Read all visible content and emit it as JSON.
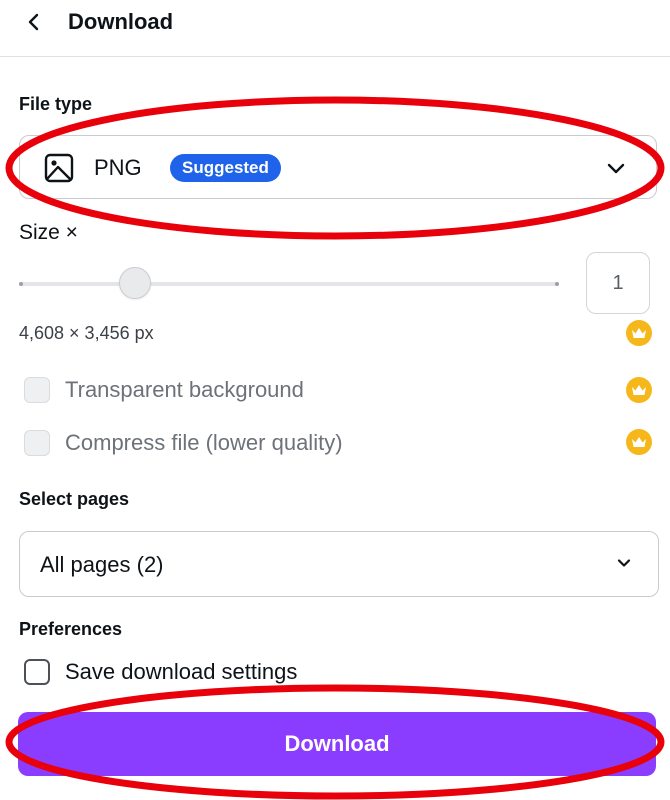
{
  "header": {
    "title": "Download",
    "back_icon": "chevron-left-icon"
  },
  "file_type": {
    "label": "File type",
    "value": "PNG",
    "icon": "image-icon",
    "badge": "Suggested"
  },
  "size": {
    "label": "Size ×",
    "value": "1",
    "slider_fraction": 0.2,
    "dimensions": "4,608 × 3,456 px"
  },
  "options": {
    "transparent_label": "Transparent background",
    "compress_label": "Compress file (lower quality)"
  },
  "pages": {
    "label": "Select pages",
    "value": "All pages (2)"
  },
  "preferences": {
    "label": "Preferences",
    "save_settings_label": "Save download settings"
  },
  "download_button": "Download",
  "colors": {
    "accent": "#8b3dff",
    "badge": "#1e63e9",
    "crown": "#f5b719",
    "annotation": "#e8000b"
  }
}
